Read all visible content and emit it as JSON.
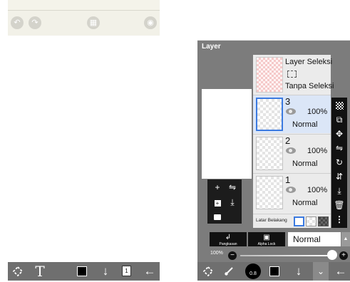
{
  "left": {
    "topbar_icons": [
      "undo-icon",
      "redo-icon",
      "grid-icon",
      "camera-icon"
    ],
    "bottom_icons": [
      "transform-icon",
      "text-tool-icon",
      "color-swatch",
      "down-arrow-icon",
      "layer-count-icon",
      "back-arrow-icon"
    ],
    "layer_count": "1",
    "text_tool_glyph": "T",
    "primary_color": "#000000"
  },
  "right": {
    "panel_title": "Layer",
    "selection_layer": {
      "title": "Layer Seleksi",
      "subtitle": "Tanpa Seleksi"
    },
    "layers": [
      {
        "number": "3",
        "opacity": "100%",
        "blend": "Normal",
        "selected": true
      },
      {
        "number": "2",
        "opacity": "100%",
        "blend": "Normal",
        "selected": false
      },
      {
        "number": "1",
        "opacity": "100%",
        "blend": "Normal",
        "selected": false
      }
    ],
    "background_label": "Latar Belakang",
    "clipping_label": "Pangkasan",
    "alpha_lock_label": "Alpha Lock",
    "blend_mode": "Normal",
    "zoom_label": "100%",
    "brush_size": "0.8",
    "primary_color": "#000000",
    "selection_color": "#3b7ae0",
    "side_tool_icons": [
      "checker-icon",
      "copy-layer-icon",
      "move-icon",
      "flip-horizontal-icon",
      "rotate-icon",
      "flip-vertical-icon",
      "merge-down-icon",
      "delete-icon",
      "more-icon"
    ],
    "bottom_icons": [
      "transform-icon",
      "brush-icon",
      "brush-size-button",
      "color-swatch",
      "down-arrow-icon",
      "collapse-icon",
      "back-arrow-icon"
    ]
  }
}
